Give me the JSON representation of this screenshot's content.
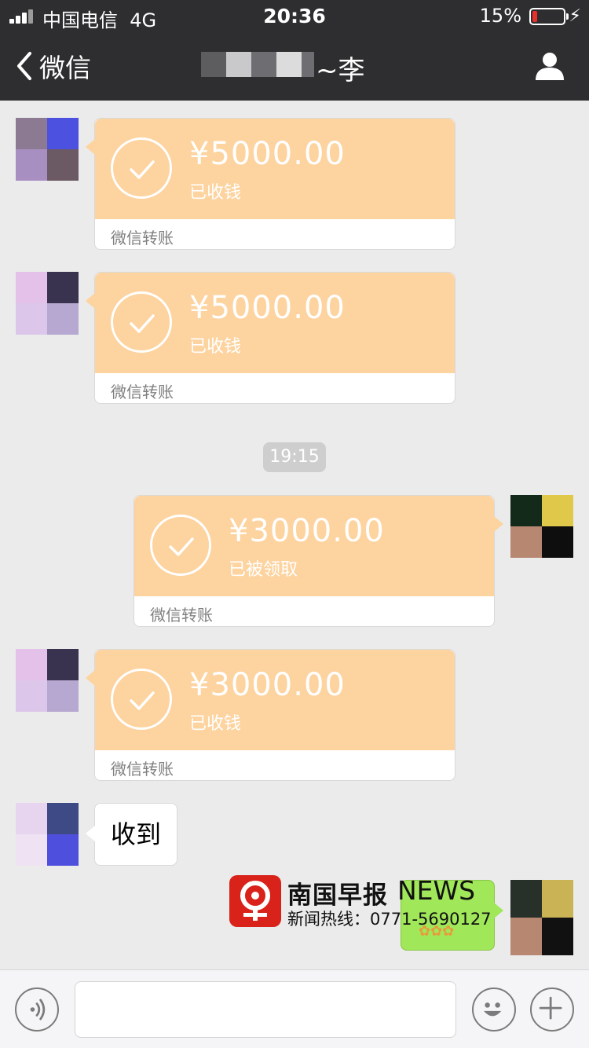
{
  "status_bar": {
    "carrier": "中国电信",
    "network": "4G",
    "time": "20:36",
    "battery_percent": "15%",
    "battery_level": 0.15
  },
  "nav": {
    "back_label": "微信",
    "title": "~李"
  },
  "messages": [
    {
      "type": "transfer",
      "side": "left",
      "amount": "¥5000.00",
      "status": "已收钱",
      "footer": "微信转账"
    },
    {
      "type": "transfer",
      "side": "left",
      "amount": "¥5000.00",
      "status": "已收钱",
      "footer": "微信转账"
    },
    {
      "type": "time",
      "text": "19:15"
    },
    {
      "type": "transfer",
      "side": "right",
      "amount": "¥3000.00",
      "status": "已被领取",
      "footer": "微信转账"
    },
    {
      "type": "transfer",
      "side": "left",
      "amount": "¥3000.00",
      "status": "已收钱",
      "footer": "微信转账"
    },
    {
      "type": "text",
      "side": "left",
      "text": "收到"
    },
    {
      "type": "sticker",
      "side": "right"
    }
  ],
  "watermark": {
    "name": "南国早报",
    "brand": "NEWS",
    "hotline": "新闻热线：0771-5690127"
  },
  "colors": {
    "transfer_bg": "#fdd39f",
    "header_bg": "#2e2e30",
    "chat_bg": "#ebebeb",
    "sent_bubble": "#a0e75a"
  },
  "icons": {
    "back": "chevron-left-icon",
    "contact": "person-icon",
    "voice": "voice-icon",
    "emoji": "smiley-icon",
    "more": "plus-icon"
  }
}
